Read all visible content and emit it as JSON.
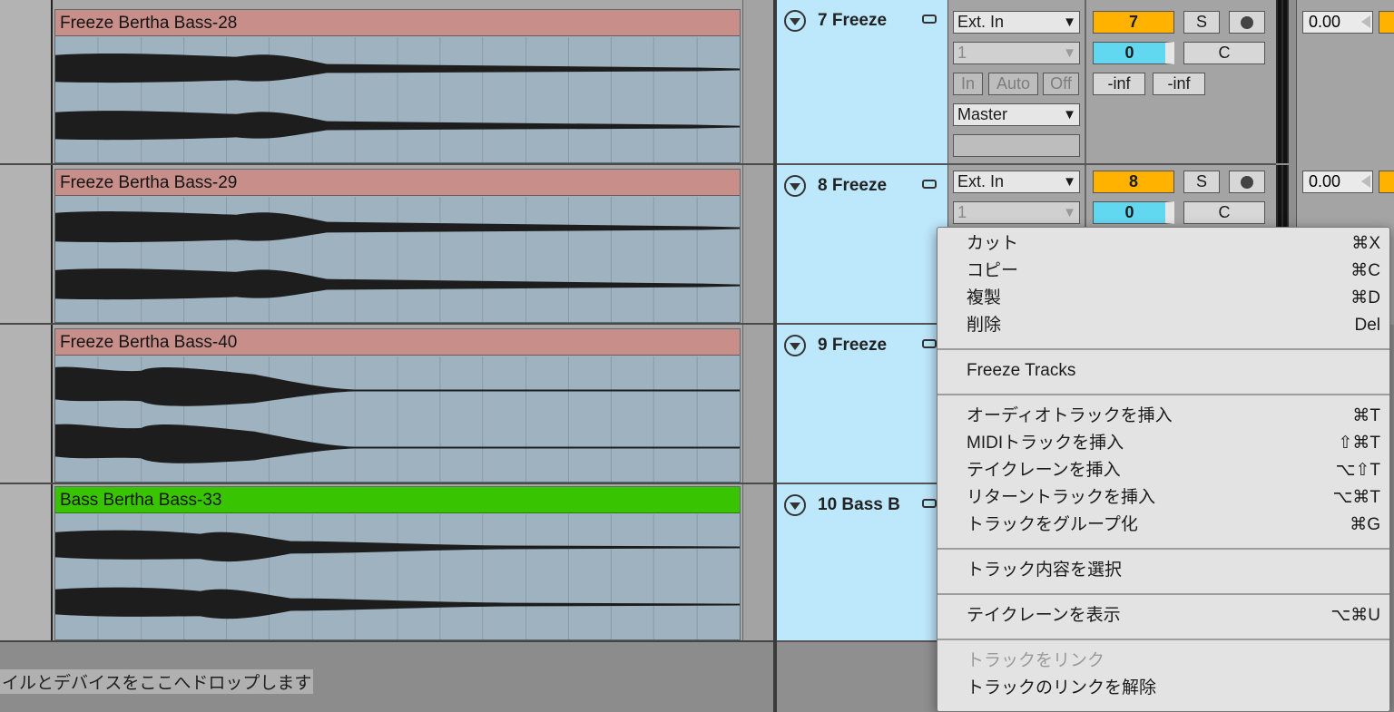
{
  "clips": [
    {
      "name": "Freeze Bertha Bass-28",
      "color": "#c88f8a"
    },
    {
      "name": "Freeze Bertha Bass-29",
      "color": "#c88f8a"
    },
    {
      "name": "Freeze Bertha Bass-40",
      "color": "#c88f8a"
    },
    {
      "name": "Bass Bertha Bass-33",
      "color": "#38c500"
    }
  ],
  "drop_zone_text": "イルとデバイスをここへドロップします",
  "tracks": [
    {
      "title": "7 Freeze",
      "input_type": "Ext. In",
      "input_channel": "1",
      "monitor": [
        "In",
        "Auto",
        "Off"
      ],
      "output": "Master",
      "number": "7",
      "solo": "S",
      "send": "0",
      "pan": "C",
      "peak_left": "-inf",
      "peak_right": "-inf",
      "volume": "0.00"
    },
    {
      "title": "8 Freeze",
      "input_type": "Ext. In",
      "input_channel": "1",
      "number": "8",
      "solo": "S",
      "send": "0",
      "pan": "C",
      "volume": "0.00"
    },
    {
      "title": "9 Freeze"
    },
    {
      "title": "10 Bass B"
    }
  ],
  "context_menu": {
    "items": [
      {
        "label": "カット",
        "shortcut": "⌘X"
      },
      {
        "label": "コピー",
        "shortcut": "⌘C"
      },
      {
        "label": "複製",
        "shortcut": "⌘D"
      },
      {
        "label": "削除",
        "shortcut": "Del"
      },
      {
        "label": "Freeze Tracks",
        "shortcut": ""
      },
      {
        "label": "オーディオトラックを挿入",
        "shortcut": "⌘T"
      },
      {
        "label": "MIDIトラックを挿入",
        "shortcut": "⇧⌘T"
      },
      {
        "label": "テイクレーンを挿入",
        "shortcut": "⌥⇧T"
      },
      {
        "label": "リターントラックを挿入",
        "shortcut": "⌥⌘T"
      },
      {
        "label": "トラックをグループ化",
        "shortcut": "⌘G"
      },
      {
        "label": "トラック内容を選択",
        "shortcut": ""
      },
      {
        "label": "テイクレーンを表示",
        "shortcut": "⌥⌘U"
      },
      {
        "label": "トラックをリンク",
        "shortcut": "",
        "disabled": true
      },
      {
        "label": "トラックのリンクを解除",
        "shortcut": ""
      }
    ]
  }
}
